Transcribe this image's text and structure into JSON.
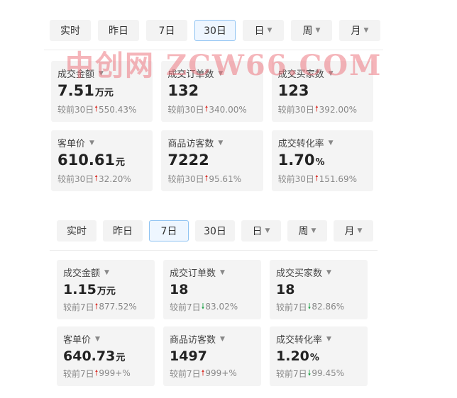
{
  "panels": [
    {
      "tabs": [
        {
          "label": "实时",
          "dropdown": false,
          "active": false
        },
        {
          "label": "昨日",
          "dropdown": false,
          "active": false
        },
        {
          "label": "7日",
          "dropdown": false,
          "active": false
        },
        {
          "label": "30日",
          "dropdown": false,
          "active": true
        },
        {
          "label": "日",
          "dropdown": true,
          "active": false
        },
        {
          "label": "周",
          "dropdown": true,
          "active": false
        },
        {
          "label": "月",
          "dropdown": true,
          "active": false
        }
      ],
      "metrics": [
        {
          "label": "成交金额",
          "value": "7.51",
          "unit": "万元",
          "compare": "较前30日",
          "direction": "up",
          "change": "550.43%"
        },
        {
          "label": "成交订单数",
          "value": "132",
          "unit": "",
          "compare": "较前30日",
          "direction": "up",
          "change": "340.00%"
        },
        {
          "label": "成交买家数",
          "value": "123",
          "unit": "",
          "compare": "较前30日",
          "direction": "up",
          "change": "392.00%"
        },
        {
          "label": "客单价",
          "value": "610.61",
          "unit": "元",
          "compare": "较前30日",
          "direction": "up",
          "change": "32.20%"
        },
        {
          "label": "商品访客数",
          "value": "7222",
          "unit": "",
          "compare": "较前30日",
          "direction": "up",
          "change": "95.61%"
        },
        {
          "label": "成交转化率",
          "value": "1.70",
          "unit": "%",
          "compare": "较前30日",
          "direction": "up",
          "change": "151.69%"
        }
      ]
    },
    {
      "tabs": [
        {
          "label": "实时",
          "dropdown": false,
          "active": false
        },
        {
          "label": "昨日",
          "dropdown": false,
          "active": false
        },
        {
          "label": "7日",
          "dropdown": false,
          "active": true
        },
        {
          "label": "30日",
          "dropdown": false,
          "active": false
        },
        {
          "label": "日",
          "dropdown": true,
          "active": false
        },
        {
          "label": "周",
          "dropdown": true,
          "active": false
        },
        {
          "label": "月",
          "dropdown": true,
          "active": false
        }
      ],
      "metrics": [
        {
          "label": "成交金额",
          "value": "1.15",
          "unit": "万元",
          "compare": "较前7日",
          "direction": "up",
          "change": "877.52%"
        },
        {
          "label": "成交订单数",
          "value": "18",
          "unit": "",
          "compare": "较前7日",
          "direction": "down",
          "change": "83.02%"
        },
        {
          "label": "成交买家数",
          "value": "18",
          "unit": "",
          "compare": "较前7日",
          "direction": "down",
          "change": "82.86%"
        },
        {
          "label": "客单价",
          "value": "640.73",
          "unit": "元",
          "compare": "较前7日",
          "direction": "up",
          "change": "999+%"
        },
        {
          "label": "商品访客数",
          "value": "1497",
          "unit": "",
          "compare": "较前7日",
          "direction": "up",
          "change": "999+%"
        },
        {
          "label": "成交转化率",
          "value": "1.20",
          "unit": "%",
          "compare": "较前7日",
          "direction": "down",
          "change": "99.45%"
        }
      ]
    }
  ],
  "watermark": "中创网 ZCW66.COM",
  "colors": {
    "up": "#d9322b",
    "down": "#21a34a",
    "active_border": "#8fc3f2",
    "card_bg": "#f4f4f4"
  }
}
